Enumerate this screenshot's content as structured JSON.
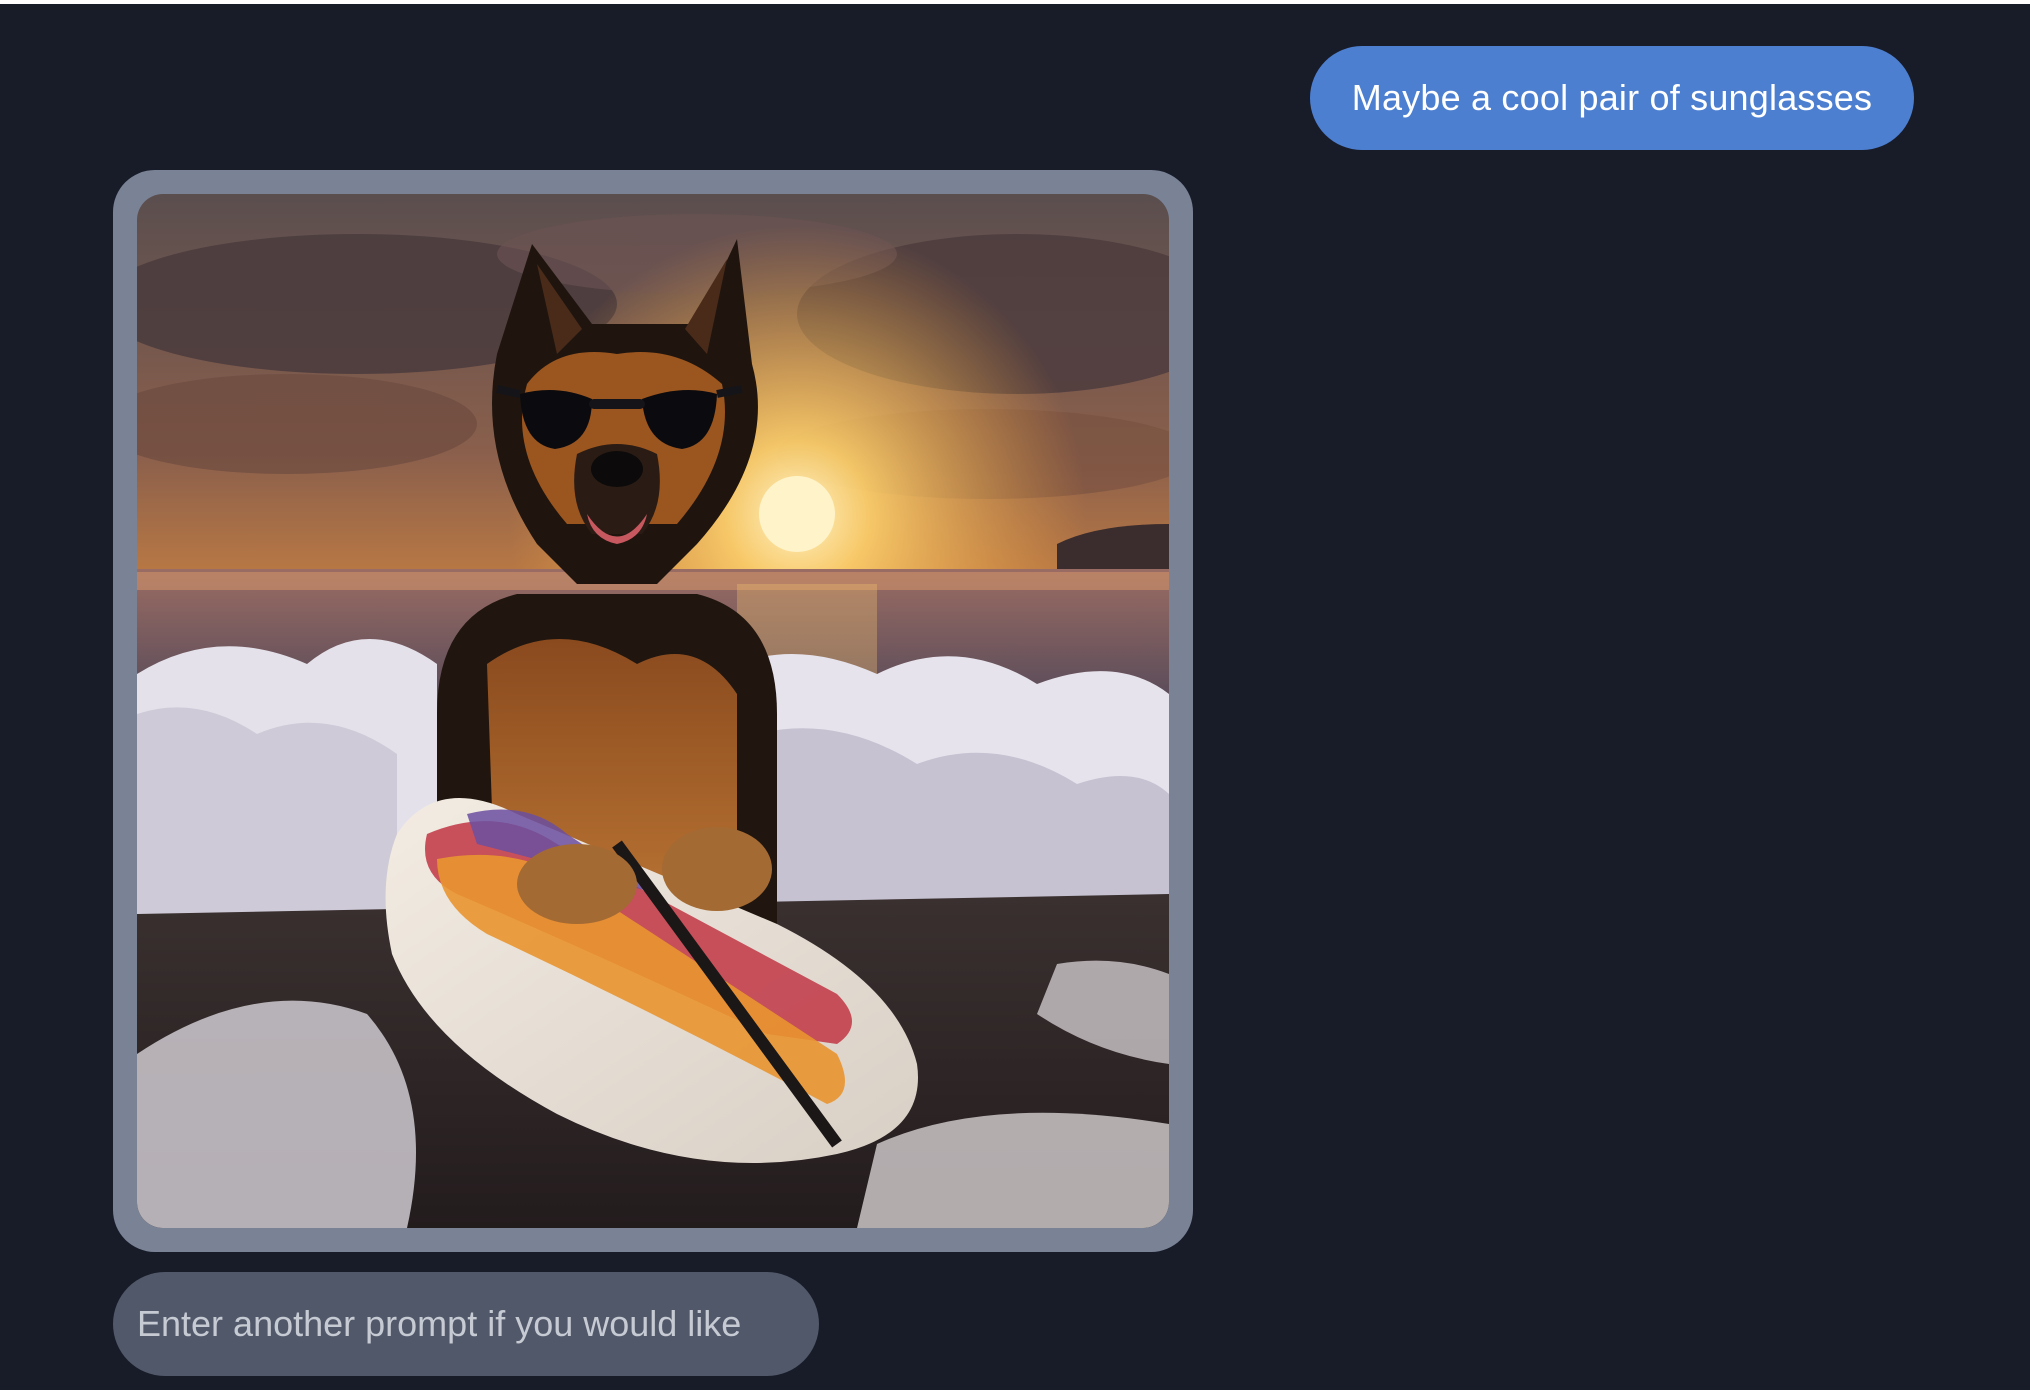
{
  "chat": {
    "user_message": "Maybe a cool pair of sunglasses",
    "prompt_placeholder": "Enter another prompt if you would like"
  },
  "generated_image": {
    "subject": "german-shepherd-with-sunglasses-on-surfboard",
    "icon": "generated-image"
  },
  "colors": {
    "background": "#181c29",
    "user_bubble": "#4d7fd0",
    "image_card_border": "#7a8296",
    "prompt_bubble": "#515869"
  }
}
